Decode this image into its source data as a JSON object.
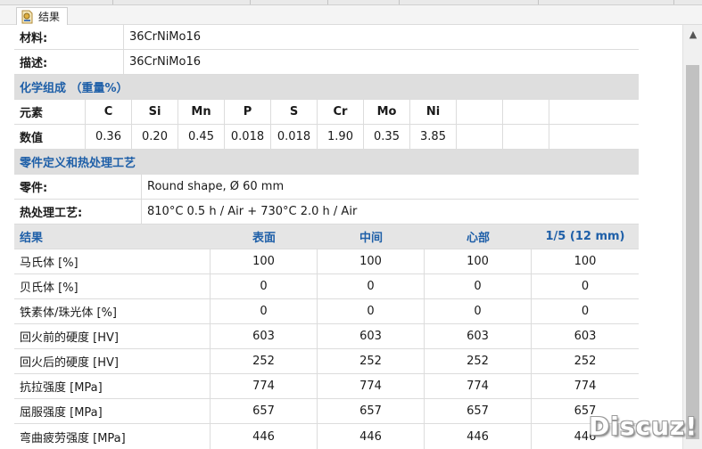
{
  "tab": {
    "label": "结果"
  },
  "material": {
    "label": "材料:",
    "value": "36CrNiMo16"
  },
  "description": {
    "label": "描述:",
    "value": "36CrNiMo16"
  },
  "composition": {
    "title": "化学组成 （重量%）",
    "element_label": "元素",
    "value_label": "数值",
    "elements": [
      "C",
      "Si",
      "Mn",
      "P",
      "S",
      "Cr",
      "Mo",
      "Ni"
    ],
    "values": [
      "0.36",
      "0.20",
      "0.45",
      "0.018",
      "0.018",
      "1.90",
      "0.35",
      "3.85"
    ]
  },
  "part_section": {
    "title": "零件定义和热处理工艺",
    "part_label": "零件:",
    "part_value": "Round shape, Ø 60 mm",
    "heat_label": "热处理工艺:",
    "heat_value": "810°C 0.5 h / Air + 730°C 2.0 h / Air"
  },
  "results": {
    "title": "结果",
    "columns": [
      "表面",
      "中间",
      "心部",
      "1/5 (12 mm)"
    ],
    "rows": [
      {
        "label": "马氏体 [%]",
        "values": [
          "100",
          "100",
          "100",
          "100"
        ]
      },
      {
        "label": "贝氏体 [%]",
        "values": [
          "0",
          "0",
          "0",
          "0"
        ]
      },
      {
        "label": "铁素体/珠光体 [%]",
        "values": [
          "0",
          "0",
          "0",
          "0"
        ]
      },
      {
        "label": "回火前的硬度 [HV]",
        "values": [
          "603",
          "603",
          "603",
          "603"
        ]
      },
      {
        "label": "回火后的硬度 [HV]",
        "values": [
          "252",
          "252",
          "252",
          "252"
        ]
      },
      {
        "label": "抗拉强度 [MPa]",
        "values": [
          "774",
          "774",
          "774",
          "774"
        ]
      },
      {
        "label": "屈服强度 [MPa]",
        "values": [
          "657",
          "657",
          "657",
          "657"
        ]
      },
      {
        "label": "弯曲疲劳强度 [MPa]",
        "values": [
          "446",
          "446",
          "446",
          "446"
        ]
      }
    ]
  },
  "watermark": "Discuz!",
  "colors": {
    "header_blue": "#1e5fa8",
    "section_bg": "#dedede",
    "grid": "#dcdcdc"
  }
}
